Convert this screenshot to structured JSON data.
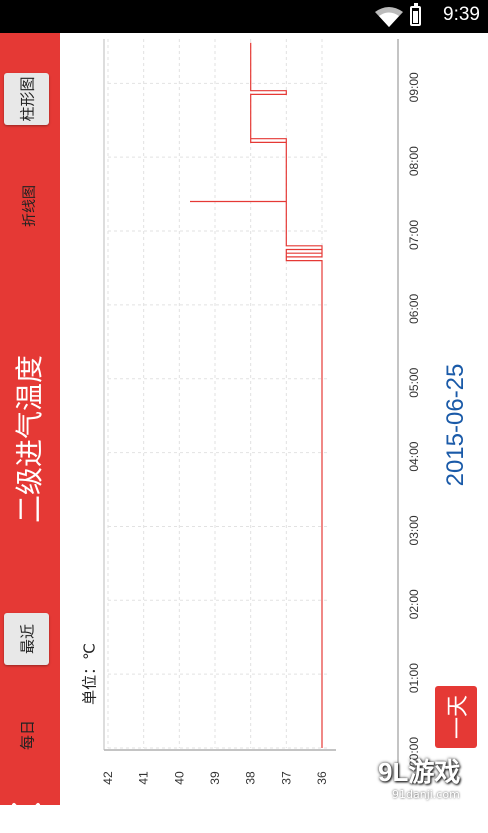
{
  "status_bar": {
    "time": "9:39"
  },
  "title_bar": {
    "title": "二级进气温度",
    "recent_button": "最近",
    "bar_chart_button": "柱形图",
    "daily_label": "每日",
    "line_chart_label": "折线图"
  },
  "chart": {
    "unit_label": "单位：℃",
    "date": "2015-06-25",
    "day_button": "一天"
  },
  "watermark": {
    "logo": "9L游戏",
    "url": "91danji.com"
  },
  "icons": {
    "back": "chevron-left-icon",
    "wifi": "wifi-icon",
    "battery": "battery-icon"
  },
  "colors": {
    "accent": "#e53935",
    "date_text": "#1a5aa8",
    "line": "#e53935"
  },
  "chart_data": {
    "type": "line",
    "x_ticks": [
      "00:00",
      "01:00",
      "02:00",
      "03:00",
      "04:00",
      "05:00",
      "06:00",
      "07:00",
      "08:00",
      "09:00"
    ],
    "y_ticks": [
      "36",
      "37",
      "38",
      "39",
      "40",
      "41",
      "42"
    ],
    "ylim": [
      36,
      42
    ],
    "xlim_hours": [
      0,
      9.6
    ],
    "series": [
      {
        "points": [
          [
            0.0,
            36.0
          ],
          [
            6.6,
            36.0
          ],
          [
            6.6,
            37.0
          ],
          [
            6.75,
            37.0
          ],
          [
            6.75,
            36.0
          ],
          [
            6.7,
            36.0
          ],
          [
            6.7,
            37.0
          ],
          [
            6.65,
            37.0
          ],
          [
            6.65,
            36.0
          ],
          [
            6.8,
            36.0
          ],
          [
            6.8,
            37.0
          ],
          [
            7.4,
            37.0
          ],
          [
            7.4,
            39.7
          ],
          [
            7.4,
            37.0
          ],
          [
            8.2,
            37.0
          ],
          [
            8.2,
            38.0
          ],
          [
            8.25,
            38.0
          ],
          [
            8.25,
            37.0
          ],
          [
            8.2,
            37.0
          ],
          [
            8.2,
            38.0
          ],
          [
            8.85,
            38.0
          ],
          [
            8.85,
            37.0
          ],
          [
            8.9,
            37.0
          ],
          [
            8.9,
            38.0
          ],
          [
            9.55,
            38.0
          ]
        ]
      }
    ]
  }
}
